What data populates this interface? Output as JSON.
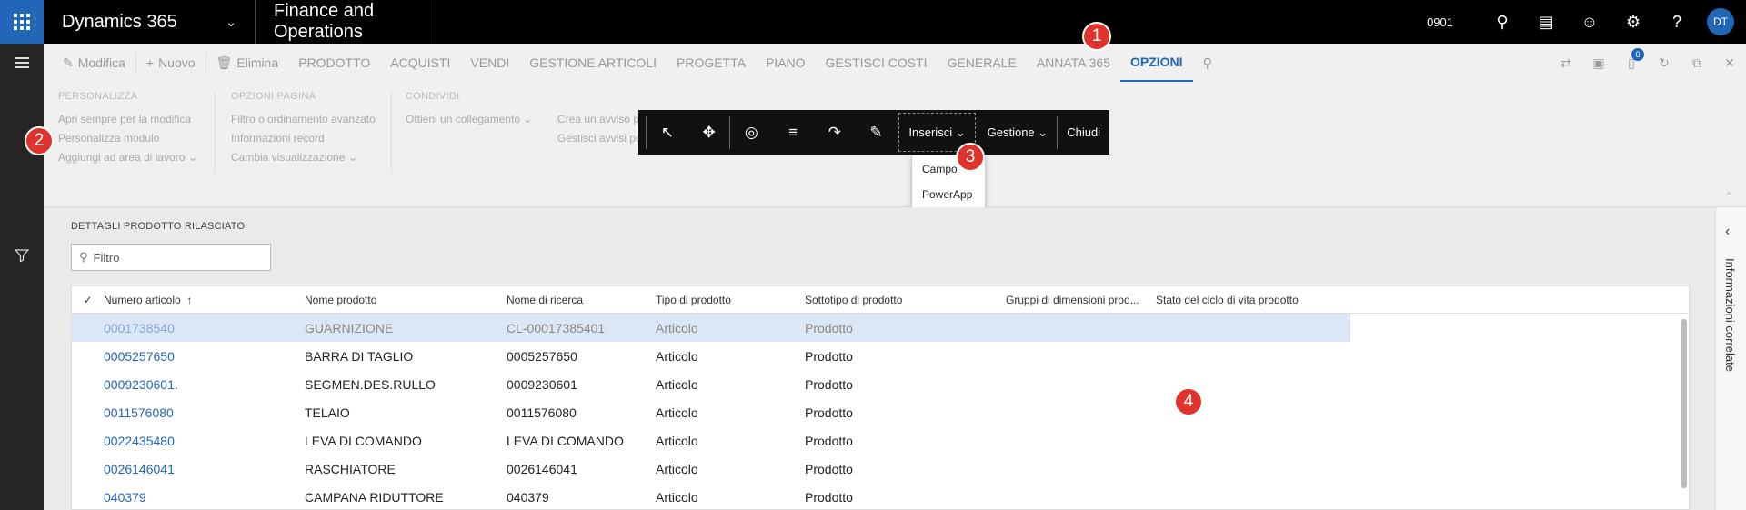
{
  "topbar": {
    "app_name": "Dynamics 365",
    "module_name": "Finance and Operations",
    "company": "0901",
    "user_initials": "DT"
  },
  "actionpane": {
    "tabs": [
      {
        "label": "Modifica",
        "icon": "pencil-icon"
      },
      {
        "label": "Nuovo",
        "icon": "plus-icon"
      },
      {
        "label": "Elimina",
        "icon": "trash-icon"
      },
      {
        "label": "PRODOTTO"
      },
      {
        "label": "ACQUISTI"
      },
      {
        "label": "VENDI"
      },
      {
        "label": "GESTIONE ARTICOLI"
      },
      {
        "label": "PROGETTA"
      },
      {
        "label": "PIANO"
      },
      {
        "label": "GESTISCI COSTI"
      },
      {
        "label": "GENERALE"
      },
      {
        "label": "ANNATA 365"
      },
      {
        "label": "OPZIONI"
      }
    ],
    "notification_count": "0",
    "groups": {
      "personalizza": {
        "title": "PERSONALIZZA",
        "items": [
          "Apri sempre per la modifica",
          "Personalizza modulo",
          "Aggiungi ad area di lavoro"
        ]
      },
      "opzioni_pagina": {
        "title": "OPZIONI PAGINA",
        "items": [
          "Filtro o ordinamento avanzato",
          "Informazioni record",
          "Cambia visualizzazione"
        ]
      },
      "condividi": {
        "title": "CONDIVIDI",
        "items": [
          "Ottieni un collegamento"
        ]
      },
      "avvisi": {
        "items": [
          "Crea un avviso p",
          "Gestisci avvisi pe"
        ]
      }
    }
  },
  "floatbar": {
    "inserisci": "Inserisci",
    "gestione": "Gestione",
    "chiudi": "Chiudi",
    "dropdown": [
      "Campo",
      "PowerApp"
    ]
  },
  "markers": [
    "1",
    "2",
    "3",
    "4"
  ],
  "content": {
    "section_title": "DETTAGLI PRODOTTO RILASCIATO",
    "filter_placeholder": "Filtro",
    "columns": [
      "Numero articolo",
      "Nome prodotto",
      "Nome di ricerca",
      "Tipo di prodotto",
      "Sottotipo di prodotto",
      "Gruppi di dimensioni prod...",
      "Stato del ciclo di vita prodotto"
    ],
    "sort_indicator": "↑",
    "rows": [
      [
        "0001738540",
        "GUARNIZIONE",
        "CL-00017385401",
        "Articolo",
        "Prodotto",
        "",
        ""
      ],
      [
        "0005257650",
        "BARRA DI TAGLIO",
        "0005257650",
        "Articolo",
        "Prodotto",
        "",
        ""
      ],
      [
        "0009230601.",
        "SEGMEN.DES.RULLO",
        "0009230601",
        "Articolo",
        "Prodotto",
        "",
        ""
      ],
      [
        "0011576080",
        "TELAIO",
        "0011576080",
        "Articolo",
        "Prodotto",
        "",
        ""
      ],
      [
        "0022435480",
        "LEVA DI COMANDO",
        "LEVA DI COMANDO",
        "Articolo",
        "Prodotto",
        "",
        ""
      ],
      [
        "0026146041",
        "RASCHIATORE",
        "0026146041",
        "Articolo",
        "Prodotto",
        "",
        ""
      ],
      [
        "040379",
        "CAMPANA RIDUTTORE",
        "040379",
        "Articolo",
        "Prodotto",
        "",
        ""
      ]
    ]
  },
  "infopane": {
    "label": "Informazioni correlate"
  }
}
